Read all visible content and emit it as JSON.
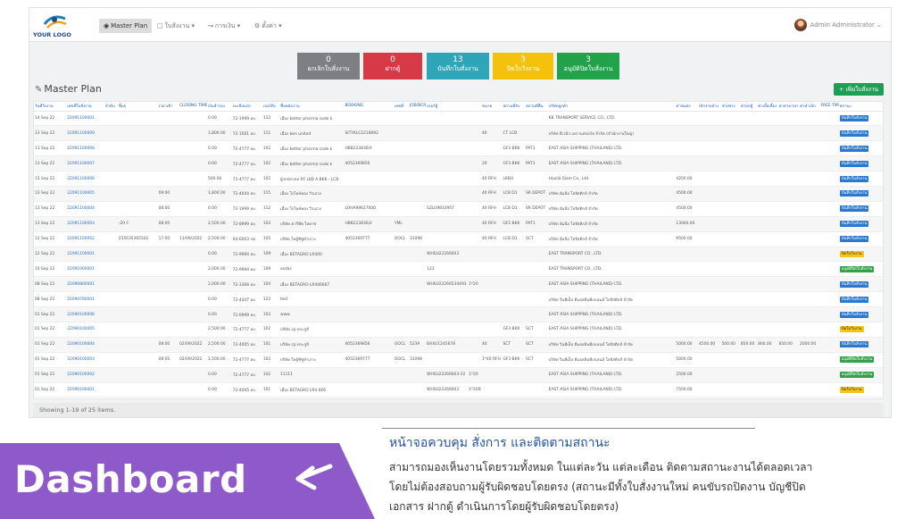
{
  "logo": {
    "text": "YOUR LOGO"
  },
  "nav": {
    "master_plan": "Master Plan",
    "work_order": "ใบสั่งงาน",
    "finance": "การเงิน",
    "settings": "ตั้งค่า",
    "user": "Admin Administrator"
  },
  "cards": [
    {
      "value": "0",
      "label": "ยกเลิกใบสั่งงาน",
      "color": "#7d7f83"
    },
    {
      "value": "0",
      "label": "ฝากตู้",
      "color": "#d63a46"
    },
    {
      "value": "13",
      "label": "บันทึกใบสั่งงาน",
      "color": "#2ea6b8"
    },
    {
      "value": "3",
      "label": "ปิดใบวีงงาน",
      "color": "#f4c20d"
    },
    {
      "value": "3",
      "label": "อนุมัติปิดใบสั่งงาน",
      "color": "#22a24a"
    }
  ],
  "page": {
    "title": "Master Plan",
    "add_button": "+ เพิ่มใบสั่งงาน",
    "summary": "Showing 1-19 of 25 items."
  },
  "table": {
    "headers": [
      "วันที่วิ่งงาน",
      "เลขที่ใบสั่งงาน",
      "ลำดับ",
      "ชิ้นๆ",
      "",
      "เวลาเข้า",
      "CLOSING TIME",
      "เงินสำรอง",
      "ทะเบียนรถ",
      "เบอร์ยิง",
      "ชื่อพนักงาน",
      "",
      "BOOKING",
      "เลขที่",
      "JOB/BCR",
      "เบอร์ตู้",
      "",
      "ขนาด",
      "สถานที่รับ",
      "สถานที่คืน",
      "บริษัทลูกค้า",
      "",
      "",
      "ค่าขนส่ง",
      "เบิกจ่ายล่วง",
      "ช่วงพ่วง",
      "ค่ายกตู้",
      "ค่าเบี้ยเลี้ยง",
      "ค่าล่วงเวลา",
      "ค่าทำเบิก",
      "FREE TIME",
      "สถานะ"
    ],
    "rows": [
      [
        "14 Sep 22",
        "22091100001",
        "",
        "",
        "",
        "",
        "",
        "0.00",
        "72-1999 อบ",
        "112",
        "เมือง better pharma code k",
        "",
        "",
        "",
        "",
        "",
        "",
        "",
        "",
        "",
        "KB TRANSPORT SERVICE CO., LTD.",
        "",
        "",
        "",
        "",
        "",
        "",
        "",
        "",
        "",
        "",
        {
          "t": "บันทึกใบสั่งงาน",
          "c": "b-blue"
        }
      ],
      [
        "13 Sep 22",
        "22091100009",
        "",
        "",
        "",
        "",
        "",
        "1,800.00",
        "72-1001 อบ",
        "111",
        "เมือง ben united",
        "",
        "SITYKLC2218092",
        "",
        "",
        "",
        "",
        "40",
        "CT LCB",
        "",
        "บริษัท อีเวนิว เทรานสปอร์ท จำกัด (สำนักงานใหญ่)",
        "",
        "",
        "",
        "",
        "",
        "",
        "",
        "",
        "",
        "",
        {
          "t": "บันทึกใบสั่งงาน",
          "c": "b-blue"
        }
      ],
      [
        "13 Sep 22",
        "22091100008",
        "",
        "",
        "",
        "",
        "",
        "0.00",
        "72-4777 อบ",
        "102",
        "เมือง better pharma code k",
        "",
        "HBB223836/4",
        "",
        "",
        "",
        "",
        "",
        "GF3 BKK",
        "PAT1",
        "EAST ASIA SHIPPING (THAILAND) LTD.",
        "",
        "",
        "",
        "",
        "",
        "",
        "",
        "",
        "",
        "",
        {
          "t": "บันทึกใบสั่งงาน",
          "c": "b-blue"
        }
      ],
      [
        "13 Sep 22",
        "22091100007",
        "",
        "",
        "",
        "",
        "",
        "0.00",
        "72-4777 อบ",
        "102",
        "เมือง better pharma code k",
        "",
        "4052369856",
        "",
        "",
        "",
        "",
        "20",
        "GF3 BKK",
        "PAT1",
        "EAST ASIA SHIPPING (THAILAND) LTD.",
        "",
        "",
        "",
        "",
        "",
        "",
        "",
        "",
        "",
        "",
        {
          "t": "บันทึกใบสั่งงาน",
          "c": "b-blue"
        }
      ],
      [
        "13 Sep 22",
        "22091100006",
        "",
        "",
        "",
        "",
        "",
        "500.00",
        "72-4777 อบ",
        "102",
        "ผู้รถนักรถท RF LKB A BKK - LCB",
        "",
        "",
        "",
        "",
        "",
        "",
        "40 RFH",
        "LKBH",
        "",
        "Houlia Siam Co., Ltd.",
        "",
        "",
        "4200.00",
        "",
        "",
        "",
        "",
        "",
        "",
        "",
        {
          "t": "บันทึกใบสั่งงาน",
          "c": "b-blue"
        }
      ],
      [
        "13 Sep 22",
        "22091100005",
        "",
        "",
        "",
        "09:00",
        "",
        "1,800.00",
        "72-4044 อบ",
        "115",
        "เมือง โกไลท์ทอง วิวเอวง",
        "",
        "",
        "",
        "",
        "",
        "",
        "40 RFH",
        "LCB D1",
        "SR DEPOT",
        "บริษัท อัมบีอ โลจิสติกส์ จำกัด",
        "",
        "",
        "4500.00",
        "",
        "",
        "",
        "",
        "",
        "",
        "",
        {
          "t": "บันทึกใบสั่งงาน",
          "c": "b-blue"
        }
      ],
      [
        "13 Sep 22",
        "22091100004",
        "",
        "",
        "",
        "08:00",
        "",
        "0.00",
        "72-1999 อบ",
        "112",
        "เมือง โกไลท์ทอง วิวเอวง",
        "",
        "LOHA99627000",
        "",
        "",
        "SZLU9810957",
        "",
        "40 RFH",
        "LCB D1",
        "SR DEPOT",
        "บริษัท อัมบีอ โลจิสติกส์ จำกัด",
        "",
        "",
        "4500.00",
        "",
        "",
        "",
        "",
        "",
        "",
        "",
        {
          "t": "บันทึกใบสั่งงาน",
          "c": "b-blue"
        }
      ],
      [
        "13 Sep 22",
        "22091100003",
        "",
        "-20 C",
        "",
        "08:00",
        "",
        "2,500.00",
        "72-8999 อบ",
        "103",
        "บริษัท ดาวีทีพ ไทยาช",
        "",
        "HBB223836/2",
        "YML",
        "",
        "",
        "",
        "40 RFH",
        "GF2 BKK",
        "PAT1",
        "บริษัท อัมบีอ โลจิสติกส์ จำกัด",
        "",
        "",
        "13000.00",
        "",
        "",
        "",
        "",
        "",
        "",
        "",
        {
          "t": "บันทึกใบสั่งงาน",
          "c": "b-blue"
        }
      ],
      [
        "12 Sep 22",
        "22091100002",
        "",
        "255635365542",
        "",
        "17:00",
        "11/09/2022",
        "2,500.00",
        "64-6003 กท",
        "105",
        "บริษัท ไทยู้ชิซู่ทำเกาะ",
        "",
        "4052369777",
        "OOCL",
        "31098",
        "",
        "",
        "40 RFH",
        "LCB D1",
        "SCT",
        "บริษัท อัมบีอ โลจิสติกส์ จำกัด",
        "",
        "",
        "9500.00",
        "",
        "",
        "",
        "",
        "",
        "",
        "",
        {
          "t": "บันทึกใบสั่งงาน",
          "c": "b-blue"
        }
      ],
      [
        "12 Sep 22",
        "22091100001",
        "",
        "",
        "",
        "",
        "",
        "0.00",
        "72-9994 อบ",
        "109",
        "เมือง BETAGRO LR400",
        "",
        "",
        "",
        "",
        "WHSU22266603",
        "",
        "",
        "",
        "",
        "EAST TRANSPORT CO., LTD.",
        "",
        "",
        "",
        "",
        "",
        "",
        "",
        "",
        "",
        "",
        {
          "t": "ปิดใบวีงงาน",
          "c": "b-yellow"
        }
      ],
      [
        "10 Sep 22",
        "22091000001",
        "",
        "",
        "",
        "",
        "",
        "2,000.00",
        "72-9994 อบ",
        "109",
        "asdas",
        "",
        "",
        "",
        "",
        "123",
        "",
        "",
        "",
        "",
        "EAST TRANSPORT CO., LTD.",
        "",
        "",
        "",
        "",
        "",
        "",
        "",
        "",
        "",
        "",
        {
          "t": "อนุมัติปิดใบสั่งงาน",
          "c": "b-green"
        }
      ],
      [
        "08 Sep 22",
        "22090800001",
        "",
        "",
        "",
        "",
        "",
        "2,000.00",
        "72-3368 อบ",
        "104",
        "เมือง BETAGRO LR406667",
        "",
        "",
        "",
        "",
        "WHSU22266534493",
        "1*20",
        "",
        "",
        "",
        "EAST ASIA SHIPPING (THAILAND) LTD.",
        "",
        "",
        "",
        "",
        "",
        "",
        "",
        "",
        "",
        "",
        {
          "t": "บันทึกใบสั่งงาน",
          "c": "b-blue"
        }
      ],
      [
        "08 Sep 22",
        "22090700001",
        "",
        "",
        "",
        "",
        "",
        "0.00",
        "72-4447 อบ",
        "122",
        "test",
        "",
        "",
        "",
        "",
        "",
        "",
        "",
        "",
        "",
        "บริษัท วินทีเอ็ป ดีแอลอินทีเกเลนส์ โลจิสติกส์ จำกัด",
        "",
        "",
        "",
        "",
        "",
        "",
        "",
        "",
        "",
        "",
        {
          "t": "บันทึกใบสั่งงาน",
          "c": "b-blue"
        }
      ],
      [
        "01 Sep 22",
        "22090100006",
        "",
        "",
        "",
        "",
        "",
        "0.00",
        "72-6999 อบ",
        "103",
        "www",
        "",
        "",
        "",
        "",
        "",
        "",
        "",
        "",
        "",
        "EAST ASIA SHIPPING (THAILAND) LTD.",
        "",
        "",
        "",
        "",
        "",
        "",
        "",
        "",
        "",
        "",
        {
          "t": "บันทึกใบสั่งงาน",
          "c": "b-blue"
        }
      ],
      [
        "01 Sep 22",
        "22090100005",
        "",
        "",
        "",
        "",
        "",
        "2,500.00",
        "72-4777 อบ",
        "102",
        "บริษัท cp ตระกูลี",
        "",
        "",
        "",
        "",
        "",
        "",
        "",
        "GF3 BKK",
        "SCT",
        "EAST ASIA SHIPPING (THAILAND) LTD.",
        "",
        "",
        "",
        "",
        "",
        "",
        "",
        "",
        "",
        "",
        {
          "t": "ปิดใบวีงงาน",
          "c": "b-yellow"
        }
      ],
      [
        "01 Sep 22",
        "22090100004",
        "",
        "",
        "",
        "08:00",
        "02/09/2022",
        "2,500.00",
        "72-4005 อบ",
        "101",
        "บริษัท cp ตระกูลี",
        "",
        "4052369856",
        "OOCL",
        "5239",
        "BAXU1245678",
        "",
        "40",
        "SCT",
        "SCT",
        "บริษัท วินทีเอ็ป ดีแอลอินทีเกเลนส์ โลจิสติกส์ จำกัด",
        "",
        "",
        "5000.00",
        "4500.00",
        "500.00",
        "850.00",
        "800.00",
        "850.00",
        "2000.00",
        "",
        {
          "t": "บันทึกใบสั่งงาน",
          "c": "b-blue"
        }
      ],
      [
        "01 Sep 22",
        "22090100003",
        "",
        "",
        "",
        "08:05",
        "02/09/2022",
        "1,500.00",
        "72-4777 อบ",
        "102",
        "บริษัท ไทยู้ชิซู่ทำเกาะ",
        "",
        "4052369777",
        "OOCL",
        "31098",
        "",
        "",
        "1*40 RFH",
        "GF3 BKK",
        "SCT",
        "บริษัท วินทีเอ็ป ดีแอลอินทีเกเลนส์ โลจิสติกส์ จำกัด",
        "",
        "",
        "5000.00",
        "",
        "",
        "",
        "",
        "",
        "",
        "",
        {
          "t": "อนุมัติปิดใบสั่งงาน",
          "c": "b-green"
        }
      ],
      [
        "01 Sep 22",
        "22090100002",
        "",
        "",
        "",
        "",
        "",
        "0.00",
        "72-4777 อบ",
        "102",
        "11111",
        "",
        "",
        "",
        "",
        "WHSU22266603-22",
        "1*20",
        "",
        "",
        "",
        "EAST ASIA SHIPPING (THAILAND) LTD.",
        "",
        "",
        "2500.00",
        "",
        "",
        "",
        "",
        "",
        "",
        "",
        {
          "t": "อนุมัติปิดใบสั่งงาน",
          "c": "b-green"
        }
      ],
      [
        "01 Sep 22",
        "22090100001",
        "",
        "",
        "",
        "",
        "",
        "0.00",
        "72-4005 อบ",
        "101",
        "เมือง BETAGRO LR4 666",
        "",
        "",
        "",
        "",
        "WHSU22266603",
        "1*20SS",
        "",
        "",
        "",
        "EAST ASIA SHIPPING (THAILAND) LTD.",
        "",
        "",
        "7500.00",
        "",
        "",
        "",
        "",
        "",
        "",
        "",
        {
          "t": "ปิดใบวีงงาน",
          "c": "b-yellow"
        }
      ]
    ]
  },
  "footer": {
    "banner_title": "Dashboard",
    "caption_title": "หน้าจอควบคุม สั่งการ และติดตามสถานะ",
    "caption_lines": [
      "สามารถมองเห็นงานโดยรวมทั้งหมด ในแต่ละวัน แต่ละเดือน ติดตามสถานะงานได้ตลอดเวลา",
      "โดยไม่ต้องสอบถามผู้รับผิดชอบโดยตรง (สถานะมีทั้งใบสั่งงานใหม่ คนขับรถปิดงาน บัญชีปิด",
      "เอกสาร ฝากตู้ ดำเนินการโดยผู้รับผิดชอบโดยตรง)"
    ]
  }
}
